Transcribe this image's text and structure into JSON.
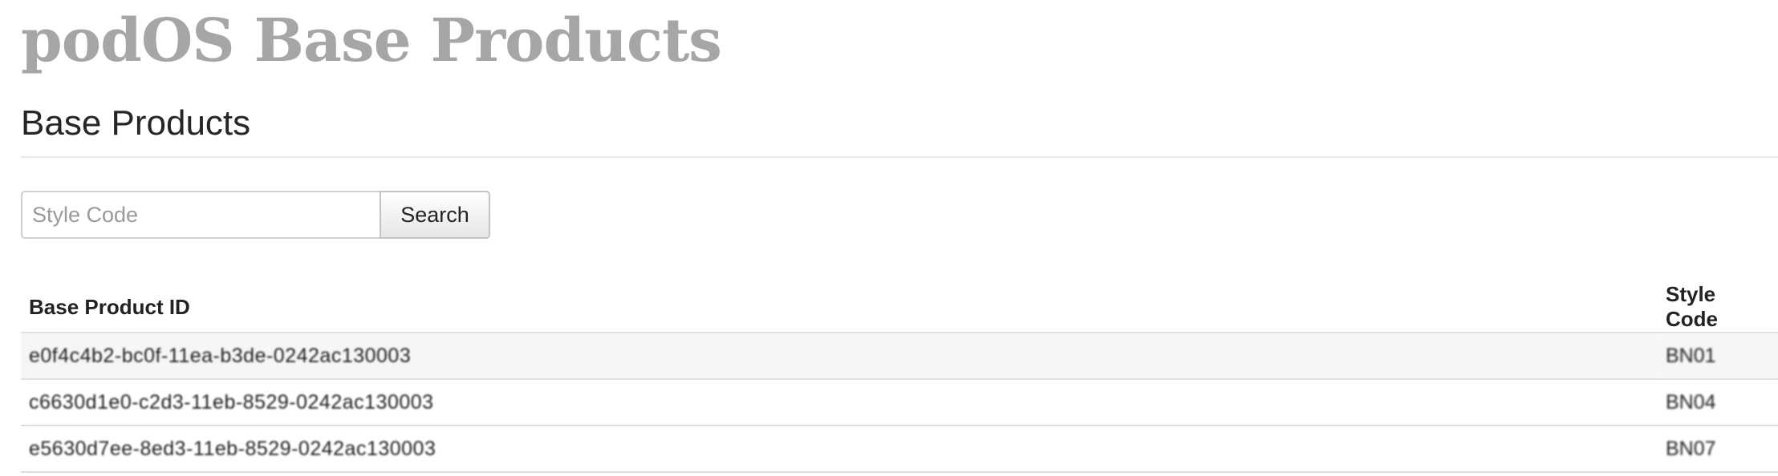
{
  "header": {
    "app_title": "podOS Base Products",
    "section_title": "Base Products"
  },
  "search": {
    "placeholder": "Style Code",
    "value": "",
    "button_label": "Search"
  },
  "table": {
    "columns": [
      "Base Product ID",
      "Style Code"
    ],
    "rows": [
      {
        "base_product_id": "e0f4c4b2-bc0f-11ea-b3de-0242ac130003",
        "style_code": "BN01"
      },
      {
        "base_product_id": "c6630d1e0-c2d3-11eb-8529-0242ac130003",
        "style_code": "BN04"
      },
      {
        "base_product_id": "e5630d7ee-8ed3-11eb-8529-0242ac130003",
        "style_code": "BN07"
      }
    ]
  },
  "colors": {
    "title_gray": "#a6a6a6",
    "row_stripe": "#f6f6f6",
    "border": "#dddddd"
  }
}
